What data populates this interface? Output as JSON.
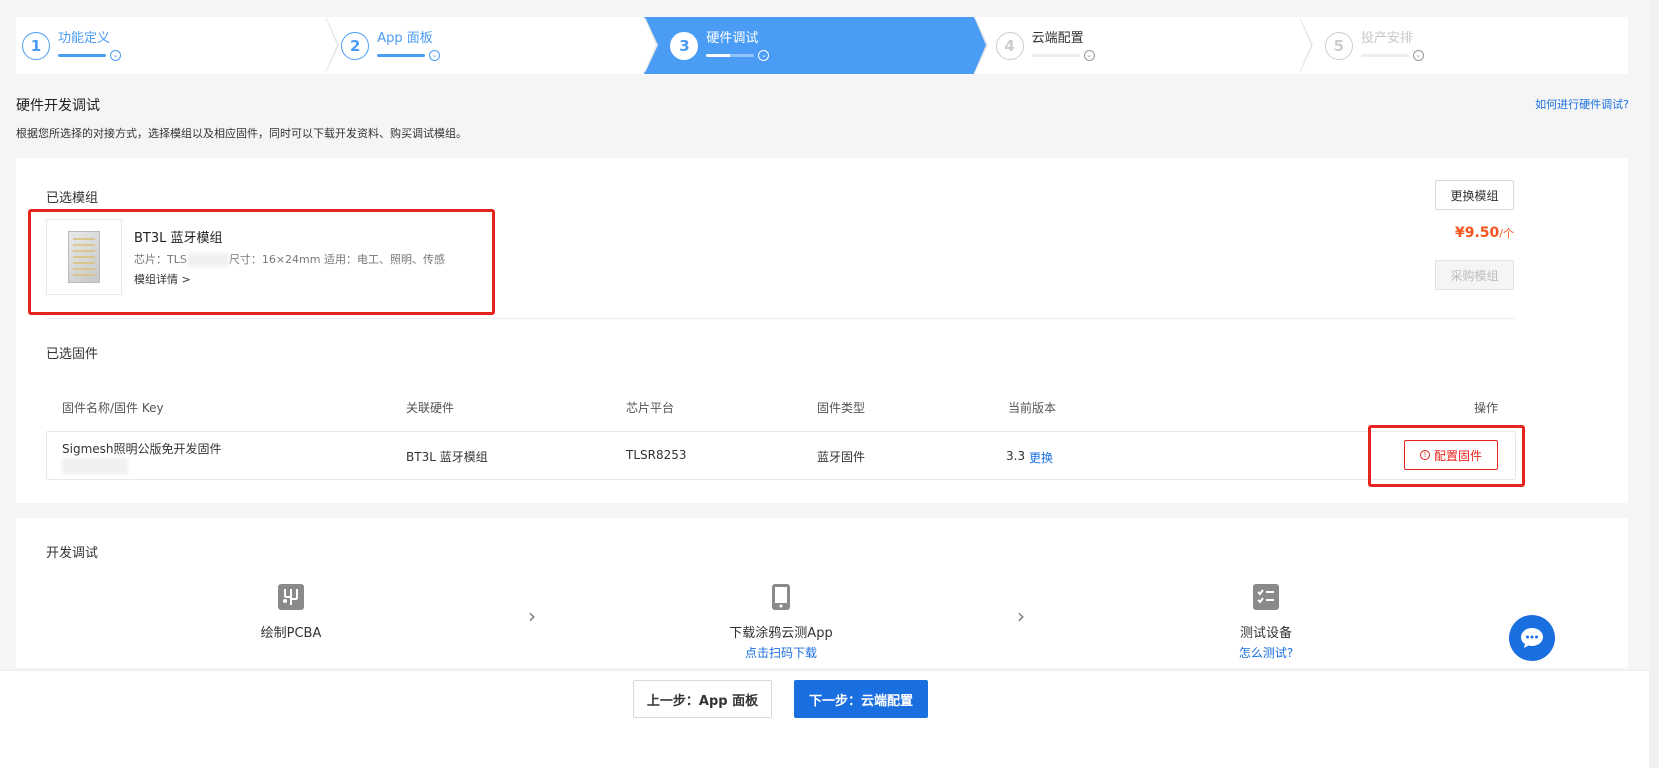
{
  "stepper": {
    "steps": [
      {
        "num": "1",
        "label": "功能定义"
      },
      {
        "num": "2",
        "label": "App 面板"
      },
      {
        "num": "3",
        "label": "硬件调试"
      },
      {
        "num": "4",
        "label": "云端配置"
      },
      {
        "num": "5",
        "label": "投产安排"
      }
    ]
  },
  "header": {
    "title": "硬件开发调试",
    "description": "根据您所选择的对接方式，选择模组以及相应固件，同时可以下载开发资料、购买调试模组。",
    "help_link": "如何进行硬件调试?"
  },
  "module": {
    "section_label": "已选模组",
    "name": "BT3L 蓝牙模组",
    "meta_prefix": "芯片：TLS",
    "meta_suffix": "尺寸：16×24mm   适用：电工、照明、传感",
    "detail_link": "模组详情 >",
    "change_button": "更换模组",
    "price": "¥9.50",
    "price_unit": "/个",
    "buy_button": "采购模组"
  },
  "firmware": {
    "section_label": "已选固件",
    "columns": [
      "固件名称/固件 Key",
      "关联硬件",
      "芯片平台",
      "固件类型",
      "当前版本",
      "操作"
    ],
    "row": {
      "name": "Sigmesh照明公版免开发固件",
      "hardware": "BT3L 蓝牙模组",
      "platform": "TLSR8253",
      "type": "蓝牙固件",
      "version": "3.3",
      "change_link": "更换",
      "config_button": "配置固件"
    }
  },
  "dev": {
    "section_label": "开发调试",
    "items": [
      {
        "label": "绘制PCBA",
        "sub": ""
      },
      {
        "label": "下载涂鸦云测App",
        "sub": "点击扫码下载"
      },
      {
        "label": "测试设备",
        "sub": "怎么测试?"
      }
    ]
  },
  "footer": {
    "prev": "上一步：App 面板",
    "next": "下一步：云端配置"
  },
  "colors": {
    "accent": "#4b9cf5",
    "link": "#1a6fe0",
    "price": "#f2551c",
    "alert": "#e8231e"
  }
}
